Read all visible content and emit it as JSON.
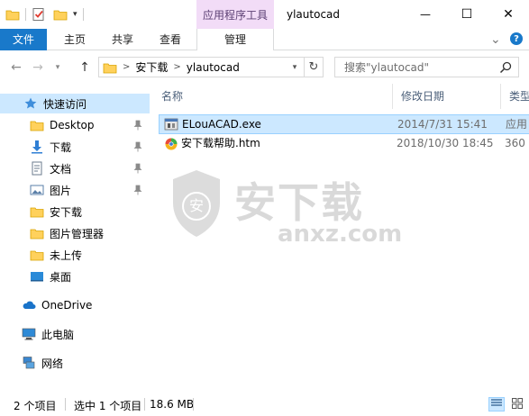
{
  "window": {
    "title": "ylautocad",
    "context_header": "应用程序工具",
    "minimize_glyph": "—",
    "maximize_glyph": "☐",
    "close_glyph": "✕"
  },
  "ribbon": {
    "tabs": [
      {
        "label": "文件"
      },
      {
        "label": "主页"
      },
      {
        "label": "共享"
      },
      {
        "label": "查看"
      },
      {
        "label": "管理"
      }
    ],
    "collapse_glyph": "⌄",
    "help_glyph": "?"
  },
  "address": {
    "crumbs": [
      "安下载",
      "ylautocad"
    ],
    "search_placeholder": "搜索\"ylautocad\""
  },
  "nav": {
    "items": [
      {
        "label": "快速访问",
        "icon": "star-icon",
        "selected": true
      },
      {
        "label": "Desktop",
        "icon": "folder-icon",
        "pinned": true
      },
      {
        "label": "下载",
        "icon": "download-icon",
        "pinned": true
      },
      {
        "label": "文档",
        "icon": "document-icon",
        "pinned": true
      },
      {
        "label": "图片",
        "icon": "picture-icon",
        "pinned": true
      },
      {
        "label": "安下载",
        "icon": "folder-icon"
      },
      {
        "label": "图片管理器",
        "icon": "folder-icon"
      },
      {
        "label": "未上传",
        "icon": "folder-icon"
      },
      {
        "label": "桌面",
        "icon": "desktop-icon"
      },
      {
        "label": "OneDrive",
        "icon": "cloud-icon"
      },
      {
        "label": "此电脑",
        "icon": "computer-icon"
      },
      {
        "label": "网络",
        "icon": "network-icon"
      }
    ]
  },
  "columns": {
    "name": "名称",
    "modified": "修改日期",
    "type": "类型"
  },
  "files": [
    {
      "name": "ELouACAD.exe",
      "modified": "2014/7/31 15:41",
      "type": "应用",
      "icon": "exe-icon",
      "selected": true
    },
    {
      "name": "安下载帮助.htm",
      "modified": "2018/10/30 18:45",
      "type": "360",
      "icon": "html-file-icon",
      "selected": false
    }
  ],
  "watermark": {
    "text": "安下载",
    "url": "anxz.com",
    "badge": "安"
  },
  "status": {
    "count": "2 个项目",
    "selected": "选中 1 个项目",
    "size": "18.6 MB"
  },
  "colors": {
    "accent": "#1979ca",
    "selection": "#cce8ff",
    "selection_border": "#99d1ff",
    "context_tab": "#f2dcf7"
  }
}
